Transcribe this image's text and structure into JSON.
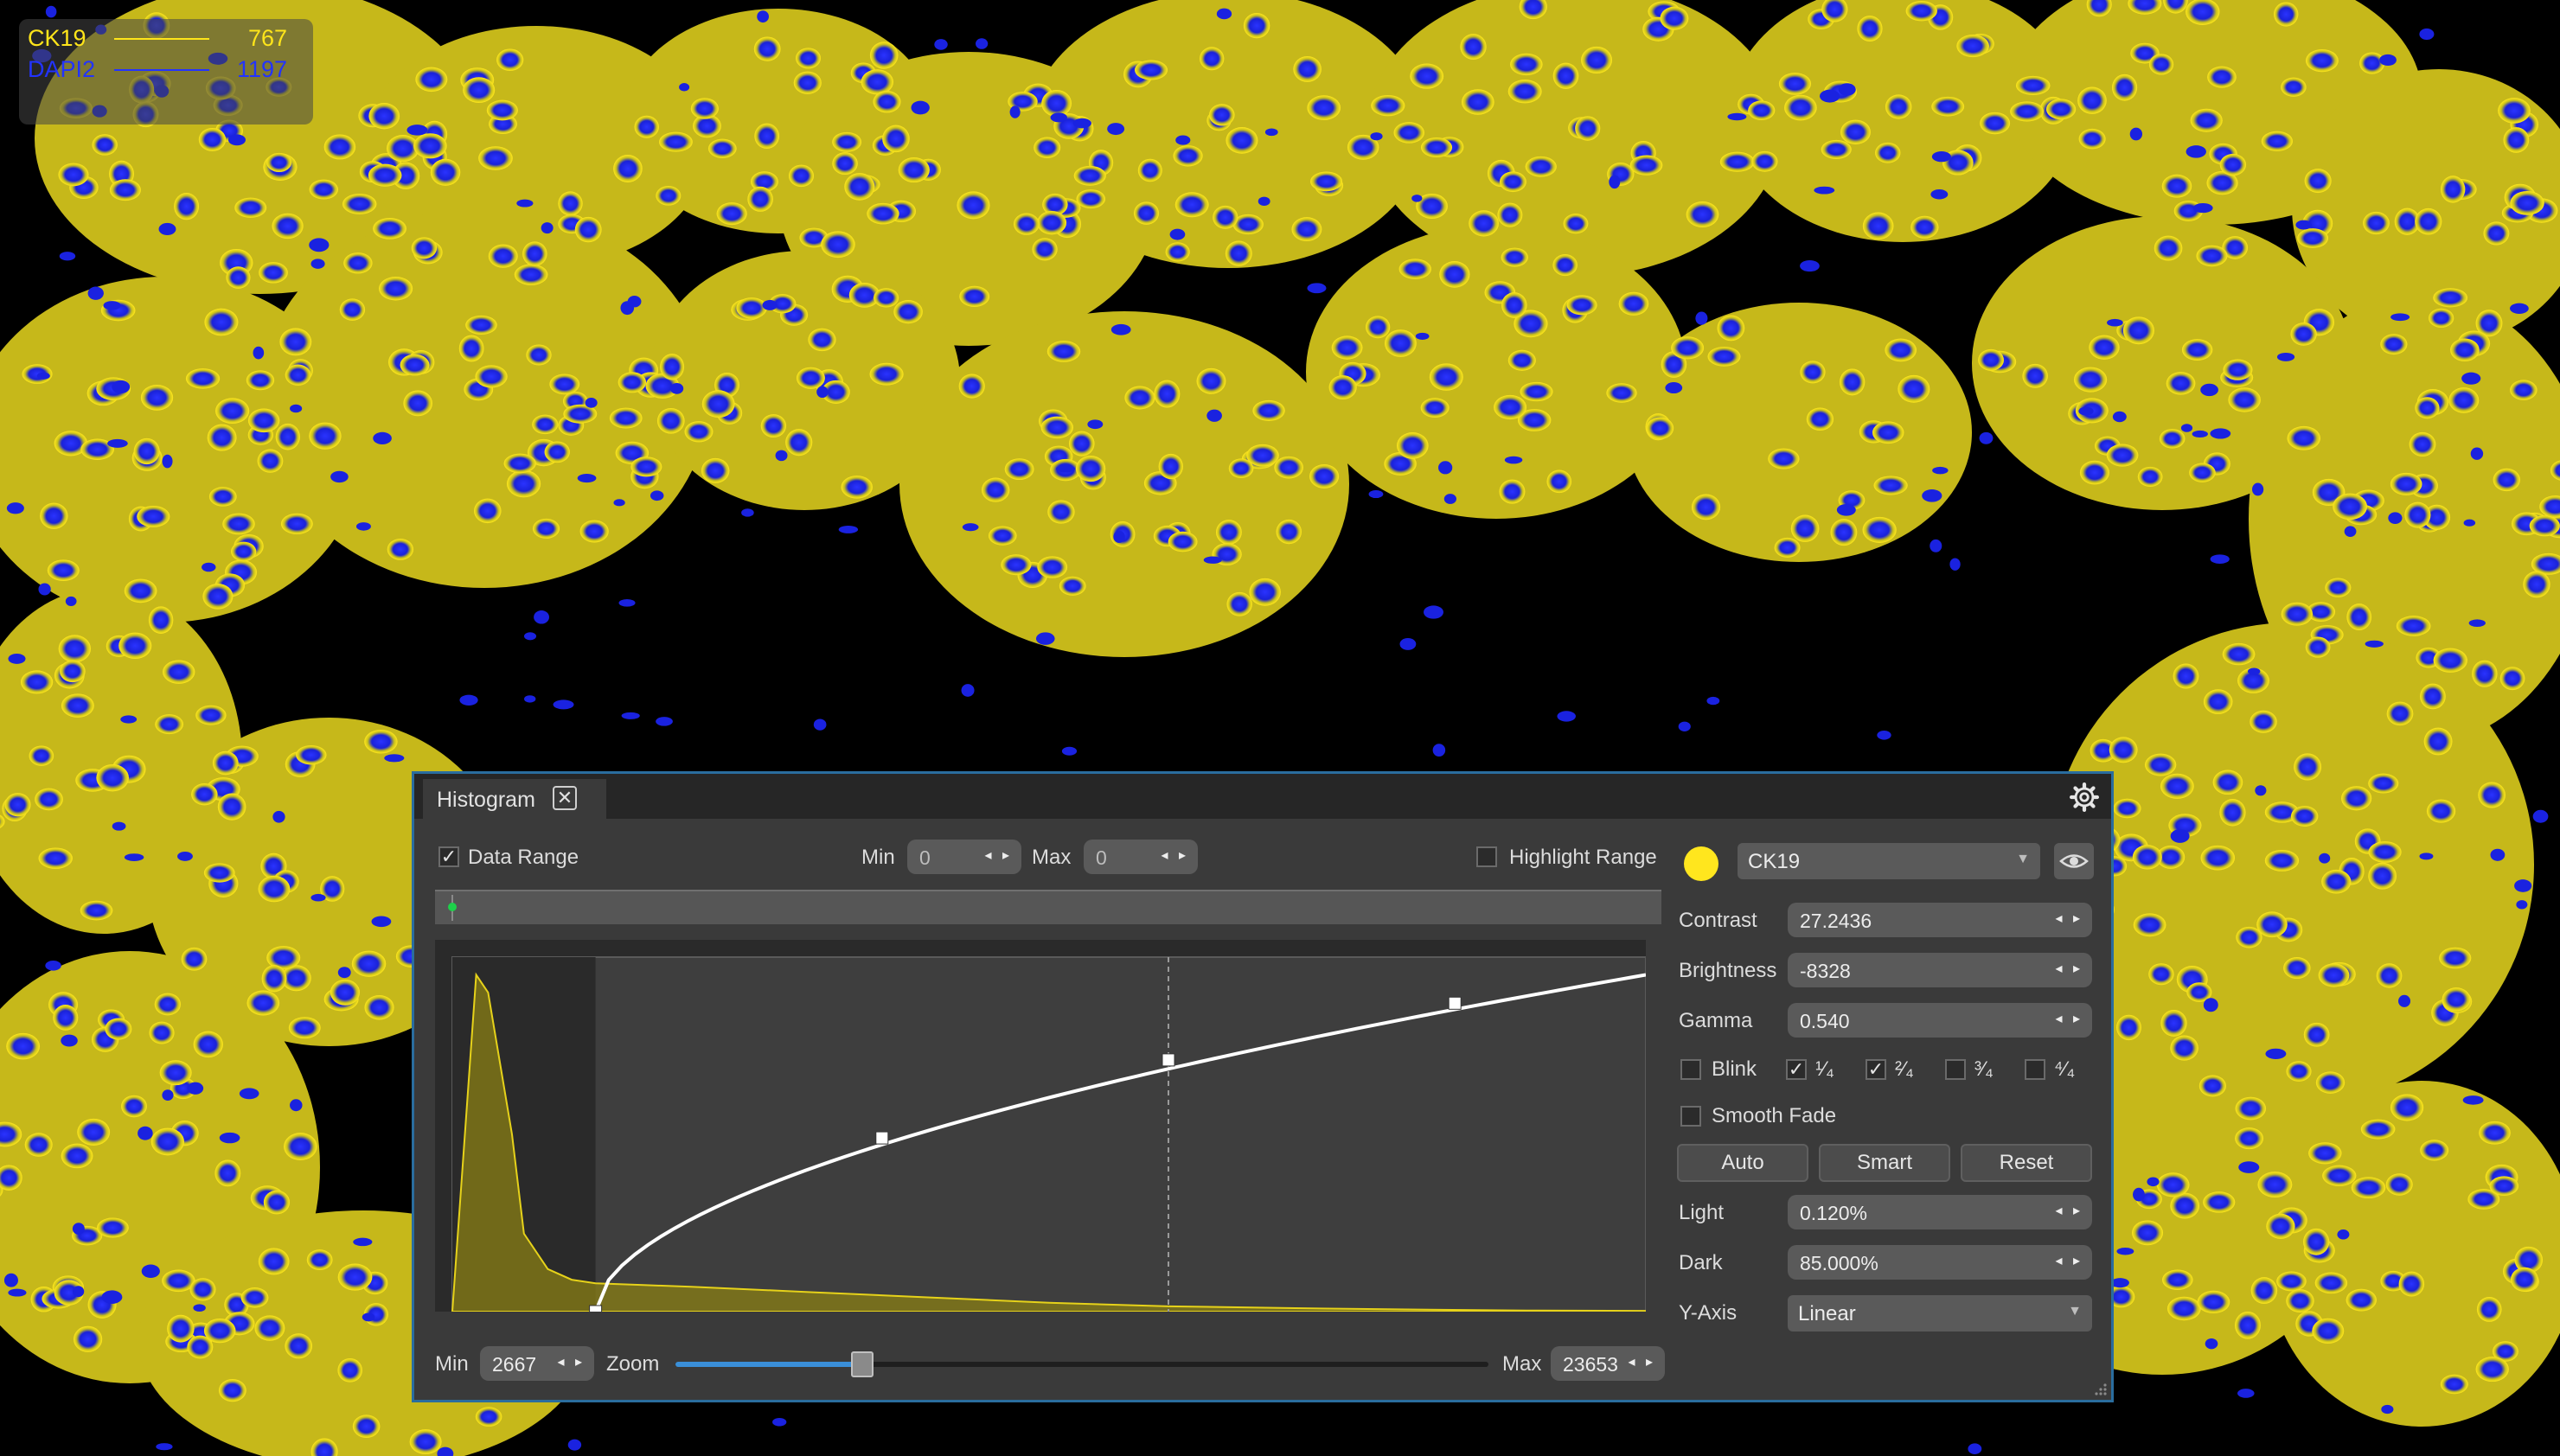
{
  "legend": [
    {
      "name": "CK19",
      "value": "767",
      "color": "#ffe51a"
    },
    {
      "name": "DAPI2",
      "value": "1197",
      "color": "#2233ff"
    }
  ],
  "panel": {
    "tab_label": "Histogram",
    "close_glyph": "✕",
    "settings_icon": "gear-icon",
    "data_range": {
      "label": "Data Range",
      "checked": true,
      "check_glyph": "✓"
    },
    "top_min": {
      "label": "Min",
      "value": "0"
    },
    "top_max": {
      "label": "Max",
      "value": "0"
    },
    "highlight_range": {
      "label": "Highlight Range",
      "checked": false
    },
    "bottom_min": {
      "label": "Min",
      "value": "2667"
    },
    "zoom": {
      "label": "Zoom",
      "level": 0.23
    },
    "bottom_max": {
      "label": "Max",
      "value": "23653"
    },
    "spin_arrows": "◂ ▸"
  },
  "channel": {
    "color": "#ffe61e",
    "name": "CK19",
    "dropdown_glyph": "▼",
    "visibility_icon": "eye-icon"
  },
  "controls": {
    "contrast": {
      "label": "Contrast",
      "value": "27.2436"
    },
    "brightness": {
      "label": "Brightness",
      "value": "-8328"
    },
    "gamma": {
      "label": "Gamma",
      "value": "0.540"
    },
    "blink": {
      "label": "Blink",
      "checked": false
    },
    "fractions": [
      {
        "label": "¹⁄₄",
        "checked": true
      },
      {
        "label": "²⁄₄",
        "checked": true
      },
      {
        "label": "³⁄₄",
        "checked": false
      },
      {
        "label": "⁴⁄₄",
        "checked": false
      }
    ],
    "smooth_fade": {
      "label": "Smooth Fade",
      "checked": false
    },
    "auto_label": "Auto",
    "smart_label": "Smart",
    "reset_label": "Reset",
    "light": {
      "label": "Light",
      "value": "0.120%"
    },
    "dark": {
      "label": "Dark",
      "value": "85.000%"
    },
    "y_axis": {
      "label": "Y-Axis",
      "value": "Linear"
    }
  },
  "chart_data": {
    "type": "area",
    "histogram_color": "#e6d21a",
    "curve_color": "#ffffff",
    "grid": false,
    "histogram": {
      "x": [
        0,
        0.02,
        0.03,
        0.05,
        0.06,
        0.08,
        0.1,
        0.12,
        0.16,
        0.2,
        0.3,
        0.4,
        0.5,
        0.6,
        0.7,
        0.8,
        0.9,
        1.0
      ],
      "y": [
        0.0,
        0.95,
        0.9,
        0.5,
        0.22,
        0.12,
        0.09,
        0.08,
        0.075,
        0.07,
        0.055,
        0.04,
        0.025,
        0.015,
        0.01,
        0.006,
        0.003,
        0.002
      ]
    },
    "curve_control_points": {
      "x": [
        0.12,
        0.36,
        0.6,
        0.84,
        1.0
      ],
      "y": [
        0.0,
        0.49,
        0.71,
        0.87,
        0.95
      ]
    },
    "unselected_range": [
      0,
      0.12
    ],
    "midline_x": 0.6
  }
}
